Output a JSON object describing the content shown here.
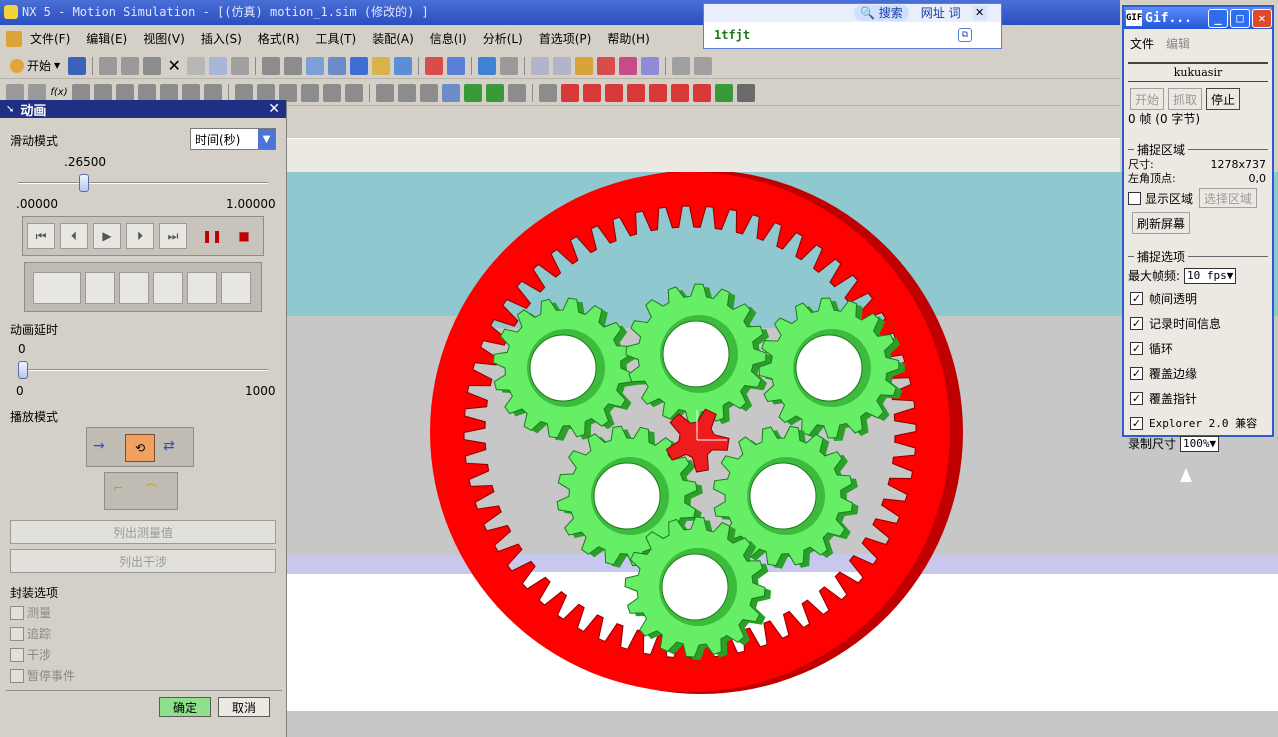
{
  "window": {
    "title": "NX 5 - Motion Simulation - [(仿真) motion_1.sim (修改的) ]"
  },
  "menubar": {
    "items": [
      "文件(F)",
      "编辑(E)",
      "视图(V)",
      "插入(S)",
      "格式(R)",
      "工具(T)",
      "装配(A)",
      "信息(I)",
      "分析(L)",
      "首选项(P)",
      "帮助(H)"
    ]
  },
  "toolbar": {
    "start_label": "开始"
  },
  "search_bar": {
    "search_label": "搜索",
    "url_label": "网址",
    "word_label": "词",
    "value": "1tfjt"
  },
  "animation_panel": {
    "title": "动画",
    "slide_mode_label": "滑动模式",
    "slide_mode_value": "时间(秒)",
    "slider_value": ".26500",
    "slider_fraction": 0.265,
    "slider_min": ".00000",
    "slider_max": "1.00000",
    "delay_label": "动画延时",
    "delay_value": "0",
    "delay_min": "0",
    "delay_max": "1000",
    "play_mode_label": "播放模式",
    "list_measure_label": "列出测量值",
    "list_interference_label": "列出干涉",
    "packaging_label": "封装选项",
    "checks": [
      "测量",
      "追踪",
      "干涉",
      "暂停事件"
    ],
    "ok_label": "确定",
    "cancel_label": "取消"
  },
  "gif_window": {
    "title": "Gif...",
    "menu": [
      "文件",
      "编辑"
    ],
    "name": "kukuasir",
    "start_label": "开始",
    "capture_label": "抓取",
    "stop_label": "停止",
    "frame_info": "0 帧 (0 字节)",
    "capture_area_label": "捕捉区域",
    "size_label": "尺寸:",
    "size_value": "1278x737",
    "origin_label": "左角顶点:",
    "origin_value": "0,0",
    "show_area_label": "显示区域",
    "select_area_label": "选择区域",
    "refresh_label": "刷新屏幕",
    "capture_options_label": "捕捉选项",
    "max_fps_label": "最大帧频:",
    "max_fps_value": "10 fps",
    "options": [
      "帧间透明",
      "记录时间信息",
      "循环",
      "覆盖边缘",
      "覆盖指针",
      "Explorer 2.0 兼容"
    ],
    "record_size_label": "录制尺寸",
    "record_size_value": "100%"
  },
  "colors": {
    "ring_gear": "#ff0000",
    "planet_gear": "#66ee66",
    "sun_gear": "#ee1c1c",
    "viewport_teal": "#8fc9cf",
    "title_blue": "#2a4fbf"
  }
}
